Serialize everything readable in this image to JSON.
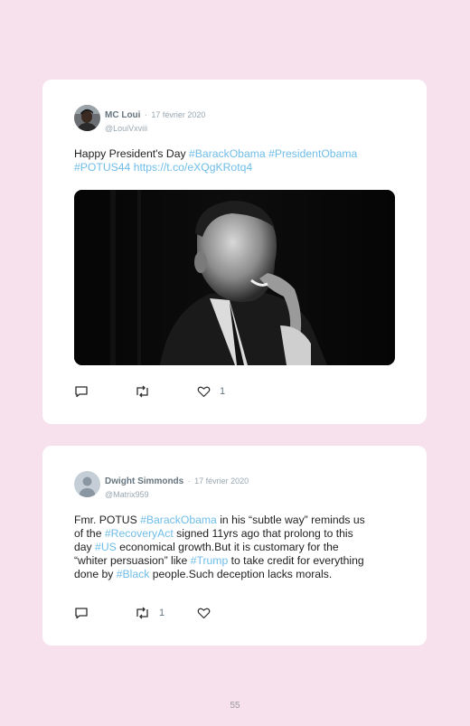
{
  "tweets": [
    {
      "author": "MC Loui",
      "separator": "·",
      "date": "17 février 2020",
      "handle": "@LouiVxviii",
      "text": {
        "l1_plain": "Happy President's Day ",
        "l1_tag1": "#BarackObama",
        "l1_space": " ",
        "l1_tag2": "#PresidentObama",
        "l2_tag": "#POTUS44",
        "l2_space": " ",
        "l2_link": "https://t.co/eXQgKRotq4"
      },
      "replies": "",
      "retweets": "",
      "likes": "1"
    },
    {
      "author": "Dwight Simmonds",
      "separator": "·",
      "date": "17 février 2020",
      "handle": "@Matrix959",
      "text": {
        "l1_plain": "Fmr. POTUS ",
        "l1_tag": "#BarackObama",
        "l1_rest": " in his “subtle way” reminds us",
        "l2_plain": "of the ",
        "l2_tag": "#RecoveryAct",
        "l2_rest": " signed 11yrs ago that prolong to this",
        "l3_plain": "day ",
        "l3_tag": "#US",
        "l3_rest": " economical growth.But it is customary for the",
        "l4_plain": "“whiter persuasion” like ",
        "l4_tag": "#Trump",
        "l4_rest": " to take credit for everything",
        "l5_plain": "done by ",
        "l5_tag": "#Black",
        "l5_rest": " people.Such deception lacks morals."
      },
      "replies": "",
      "retweets": "1",
      "likes": ""
    }
  ],
  "icons": {
    "reply": "reply-icon",
    "retweet": "retweet-icon",
    "like": "heart-icon"
  },
  "colors": {
    "page_background": "#f6e1ec",
    "card": "#ffffff",
    "hashtag": "#6fbde8",
    "name": "#66757f",
    "muted": "#99a7b2"
  },
  "page_number": "55"
}
